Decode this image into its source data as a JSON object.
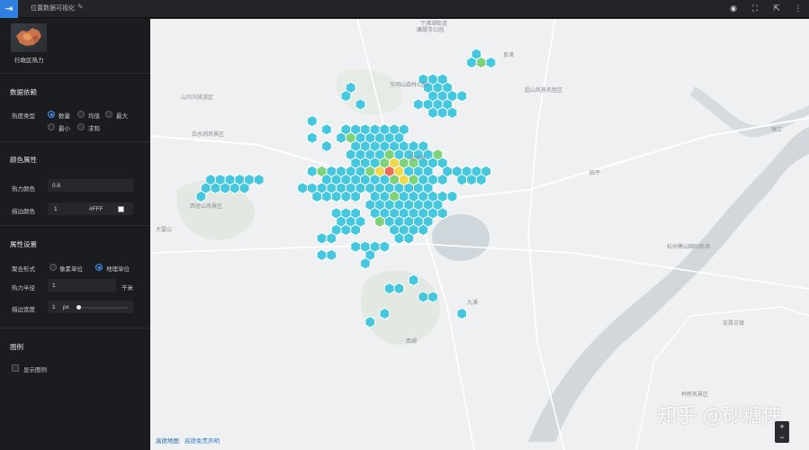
{
  "topbar": {
    "title": "位置数据可视化",
    "icons": [
      "eye-icon",
      "fullscreen-icon",
      "share-icon",
      "more-icon"
    ]
  },
  "sidebar": {
    "layer_thumb_label": "行政区热力",
    "data_section": {
      "title": "数据依赖",
      "heat_type_label": "热度类型",
      "options": [
        "数量",
        "均值",
        "最大",
        "最小",
        "求和"
      ],
      "selected": "数量"
    },
    "color_section": {
      "title": "颜色属性",
      "heat_color_label": "热力颜色",
      "heat_opacity": "0.8",
      "stroke_color_label": "描边颜色",
      "stroke_opacity": "1",
      "stroke_color_hex": "#FFF"
    },
    "attr_section": {
      "title": "属性设置",
      "aggregate_label": "聚合形式",
      "aggregate_options": [
        "像素单位",
        "地理单位"
      ],
      "aggregate_selected": "地理单位",
      "radius_label": "热力半径",
      "radius_value": "1",
      "radius_unit": "千米",
      "stroke_width_label": "描边宽度",
      "stroke_width_value": "1",
      "stroke_width_unit": "px"
    },
    "legend_section": {
      "title": "图例",
      "show_legend_label": "显示图例"
    }
  },
  "map": {
    "labels": [
      "下渚湖街道",
      "康履寺公园",
      "良渚",
      "东明山森林公园",
      "超山风景名胜区",
      "山沟沟旅游区",
      "白水涧风景区",
      "西径山风景区",
      "大雷山",
      "杭州市",
      "临平",
      "杭州萧山国际机场",
      "九溪",
      "西湖",
      "安昌古镇",
      "钱江",
      "柯桥风景区"
    ],
    "credit_brand": "高德地图",
    "credit_link": "高德免责声明",
    "watermark": "知乎 @砂糖侠",
    "colors": {
      "hex_low": "#45c7de",
      "hex_mid": "#7ed27a",
      "hex_high": "#f0d84a",
      "hex_peak": "#ee6a5a",
      "hex_stroke": "#ffffff",
      "river": "#d2d7dc",
      "water": "#cfd6dc",
      "green": "#e2e8e2"
    }
  }
}
